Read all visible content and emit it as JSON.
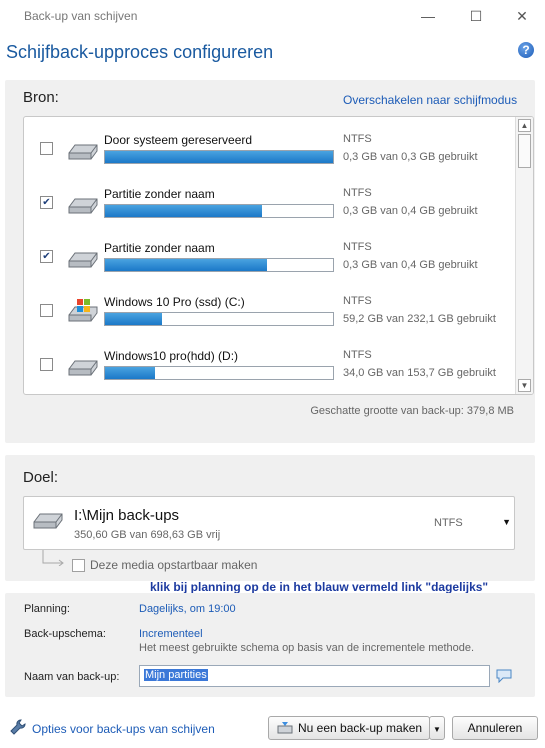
{
  "window": {
    "title": "Back-up van schijven",
    "minimize": "—",
    "maximize": "☐",
    "close": "✕"
  },
  "header": {
    "title": "Schijfback-upproces configureren",
    "help": "?"
  },
  "source": {
    "label": "Bron:",
    "switch_link": "Overschakelen naar schijfmodus",
    "partitions": [
      {
        "name": "Door systeem gereserveerd",
        "checked": false,
        "fs": "NTFS",
        "usage": "0,3 GB van 0,3 GB gebruikt",
        "fill": 1.0,
        "check": ""
      },
      {
        "name": "Partitie zonder naam",
        "checked": true,
        "fs": "NTFS",
        "usage": "0,3 GB van 0,4 GB gebruikt",
        "fill": 0.69,
        "check": "✔"
      },
      {
        "name": "Partitie zonder naam",
        "checked": true,
        "fs": "NTFS",
        "usage": "0,3 GB van 0,4 GB gebruikt",
        "fill": 0.71,
        "check": "✔"
      },
      {
        "name": "Windows 10 Pro (ssd) (C:)",
        "checked": false,
        "fs": "NTFS",
        "usage": "59,2 GB van 232,1 GB gebruikt",
        "fill": 0.25,
        "check": ""
      },
      {
        "name": "Windows10 pro(hdd) (D:)",
        "checked": false,
        "fs": "NTFS",
        "usage": "34,0 GB van 153,7 GB gebruikt",
        "fill": 0.22,
        "check": ""
      }
    ],
    "estimate": "Geschatte grootte van back-up: 379,8 MB"
  },
  "destination": {
    "label": "Doel:",
    "name": "I:\\Mijn back-ups",
    "free": "350,60 GB van 698,63 GB vrij",
    "fs": "NTFS",
    "bootable_label": "Deze media opstartbaar maken"
  },
  "annotation": "klik bij planning op de in het blauw vermeld link \"dagelijks\"",
  "settings": {
    "planning_label": "Planning:",
    "planning_value": "Dagelijks, om 19:00",
    "scheme_label": "Back-upschema:",
    "scheme_value": "Incrementeel",
    "scheme_desc": "Het meest gebruikte schema op basis van de incrementele methode.",
    "name_label": "Naam van back-up:",
    "name_value": "Mijn partities"
  },
  "footer": {
    "options_link": "Opties voor back-ups van schijven",
    "backup_button": "Nu een back-up maken",
    "cancel_button": "Annuleren"
  },
  "colors": {
    "accent": "#1d5cb7",
    "bar_fill": "#1b78c8",
    "annotation": "#1c3aa0"
  }
}
